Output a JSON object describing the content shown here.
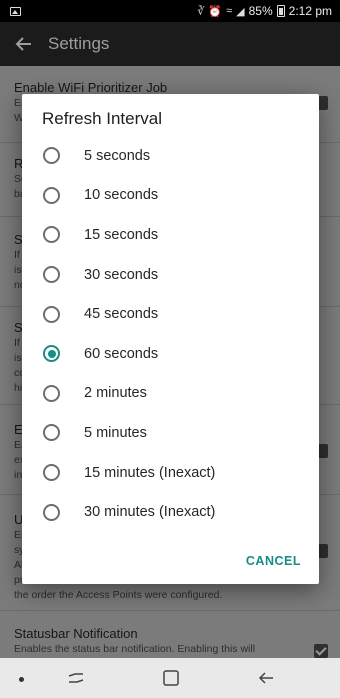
{
  "statusbar": {
    "battery": "85%",
    "time": "2:12 pm"
  },
  "appbar": {
    "title": "Settings"
  },
  "settings_items": [
    {
      "title": "Enable WiFi Prioritizer Job",
      "summary": [
        "En",
        "W"
      ]
    },
    {
      "title": "R",
      "summary": [
        "Se",
        "ba"
      ]
    },
    {
      "title": "S",
      "summary": [
        "If",
        "is",
        "no"
      ]
    },
    {
      "title": "S",
      "summary": [
        "If",
        "is",
        "co",
        "hi"
      ]
    },
    {
      "title": "E",
      "summary": [
        "Er",
        "ex",
        "in"
      ]
    },
    {
      "title": "U",
      "summary": [
        "Er",
        "sy",
        "Al",
        "pr",
        "the order the Access Points were configured."
      ]
    },
    {
      "title": "Statusbar Notification",
      "summary": [
        "Enables the status bar notification. Enabling this will"
      ]
    }
  ],
  "dialog": {
    "title": "Refresh Interval",
    "options": [
      {
        "label": "5 seconds",
        "selected": false
      },
      {
        "label": "10 seconds",
        "selected": false
      },
      {
        "label": "15 seconds",
        "selected": false
      },
      {
        "label": "30 seconds",
        "selected": false
      },
      {
        "label": "45 seconds",
        "selected": false
      },
      {
        "label": "60 seconds",
        "selected": true
      },
      {
        "label": "2 minutes",
        "selected": false
      },
      {
        "label": "5 minutes",
        "selected": false
      },
      {
        "label": "15 minutes (Inexact)",
        "selected": false
      },
      {
        "label": "30 minutes (Inexact)",
        "selected": false
      }
    ],
    "cancel_label": "CANCEL"
  },
  "colors": {
    "accent": "#178e84",
    "scrim": "#7b7b7b",
    "appbar": "#1b1b1b"
  }
}
